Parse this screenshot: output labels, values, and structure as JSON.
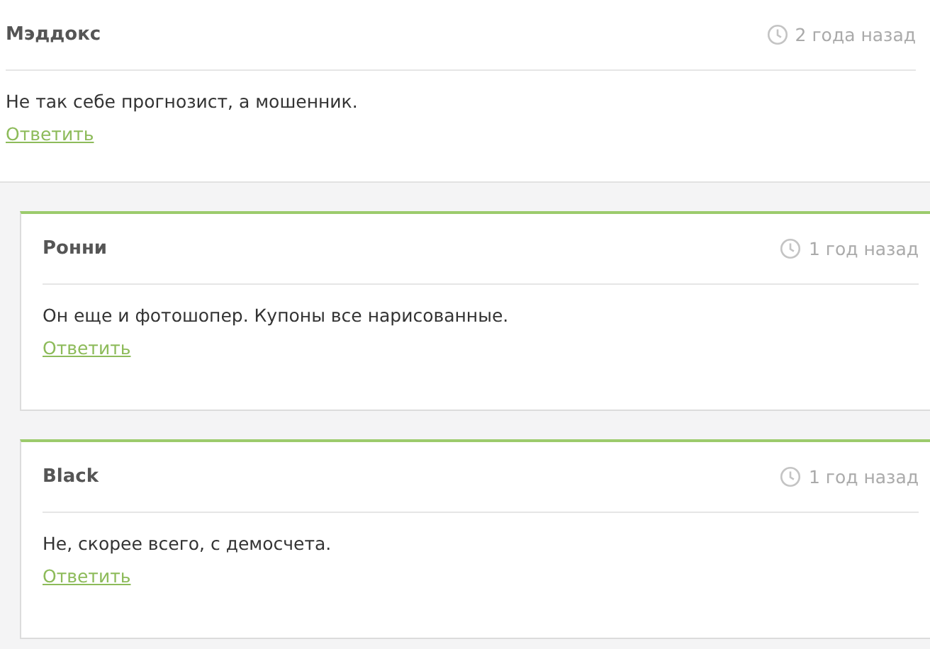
{
  "comments": [
    {
      "author": "Мэддокс",
      "time": "2 года назад",
      "text": "Не так себе прогнозист, а мошенник.",
      "reply": "Ответить",
      "children": [
        {
          "author": "Ронни",
          "time": "1 год назад",
          "text": "Он еще и фотошопер. Купоны все нарисованные.",
          "reply": "Ответить"
        },
        {
          "author": "Black",
          "time": "1 год назад",
          "text": "Не, скорее всего, с демосчета.",
          "reply": "Ответить"
        }
      ]
    }
  ]
}
